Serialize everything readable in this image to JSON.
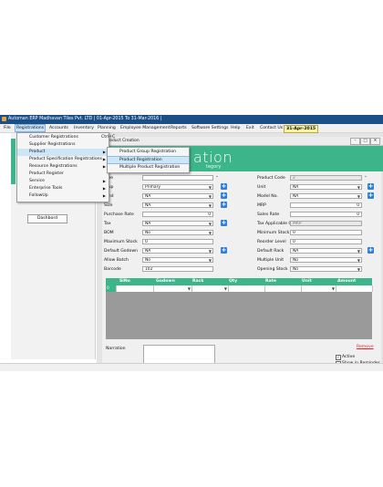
{
  "window": {
    "title": "Automan ERP Madhavan Tiles Pvt. LTD | 01-Apr-2015 To 31-Mar-2016 |"
  },
  "menubar": {
    "items": [
      "File",
      "Registrations",
      "Accounts",
      "Inventory",
      "Planning",
      "Employee Management",
      "Reports",
      "Software Settings",
      "Help",
      "Exit",
      "Contact Us"
    ],
    "date": "31-Apr-2015"
  },
  "registrations_menu": {
    "items": [
      {
        "label": "Customer Registrations",
        "shortcut": "Ctrl+C",
        "submenu": false
      },
      {
        "label": "Supplier Registrations",
        "shortcut": "",
        "submenu": false
      },
      {
        "label": "Product",
        "shortcut": "",
        "submenu": true
      },
      {
        "label": "Product Specification Registrations",
        "shortcut": "",
        "submenu": true
      },
      {
        "label": "Resource Registrations",
        "shortcut": "",
        "submenu": true
      },
      {
        "label": "Product Register",
        "shortcut": "",
        "submenu": false
      },
      {
        "label": "Service",
        "shortcut": "",
        "submenu": true
      },
      {
        "label": "Enterprise Tools",
        "shortcut": "",
        "submenu": true
      },
      {
        "label": "FollowUp",
        "shortcut": "",
        "submenu": true
      }
    ]
  },
  "product_submenu": {
    "items": [
      "Product Group Registration",
      "Product Registration",
      "Multiple Product Registration"
    ]
  },
  "sidebar": {
    "dashboard_label": "Dashbord"
  },
  "child_window": {
    "title": "Product Creation",
    "banner_title": "ation",
    "banner_subtitle": "tegory"
  },
  "form": {
    "left": [
      {
        "label": "ame",
        "value": "",
        "type": "text"
      },
      {
        "label": "roup",
        "value": "Primary",
        "type": "select"
      },
      {
        "label": "rand",
        "value": "NA",
        "type": "select"
      },
      {
        "label": "Size",
        "value": "NA",
        "type": "select"
      },
      {
        "label": "Purchase Rate",
        "value": "0",
        "type": "number"
      },
      {
        "label": "Tax",
        "value": "NA",
        "type": "select"
      },
      {
        "label": "BOM",
        "value": "No",
        "type": "select"
      },
      {
        "label": "Maximum Stock",
        "value": "0",
        "type": "text"
      },
      {
        "label": "Default Godown",
        "value": "NA",
        "type": "select"
      },
      {
        "label": "Allow Batch",
        "value": "No",
        "type": "select"
      },
      {
        "label": "Barcode",
        "value": "102",
        "type": "text"
      }
    ],
    "right": [
      {
        "label": "Product Code",
        "value": "2",
        "type": "grey"
      },
      {
        "label": "Unit",
        "value": "NA",
        "type": "select"
      },
      {
        "label": "Model No.",
        "value": "NA",
        "type": "select"
      },
      {
        "label": "MRP",
        "value": "0",
        "type": "number"
      },
      {
        "label": "Sales Rate",
        "value": "0",
        "type": "number"
      },
      {
        "label": "Tax Applicable On",
        "value": "MRP",
        "type": "grey"
      },
      {
        "label": "Minimum Stock",
        "value": "0",
        "type": "text"
      },
      {
        "label": "Reorder Level",
        "value": "0",
        "type": "text"
      },
      {
        "label": "Default Rack",
        "value": "NA",
        "type": "select"
      },
      {
        "label": "Multiple Unit",
        "value": "No",
        "type": "select"
      },
      {
        "label": "Opening Stock",
        "value": "No",
        "type": "select"
      }
    ],
    "star": "*"
  },
  "grid": {
    "headers": [
      "SlNo",
      "Godown",
      "Rack",
      "Qty",
      "Rate",
      "Unit",
      "Amount"
    ],
    "first_row_slno": "0"
  },
  "bottom": {
    "narration_label": "Narration",
    "remove_label": "Remove",
    "active_label": "Active",
    "active_checked": true,
    "reminder_label": "Show in Reminder",
    "reminder_checked": false
  }
}
